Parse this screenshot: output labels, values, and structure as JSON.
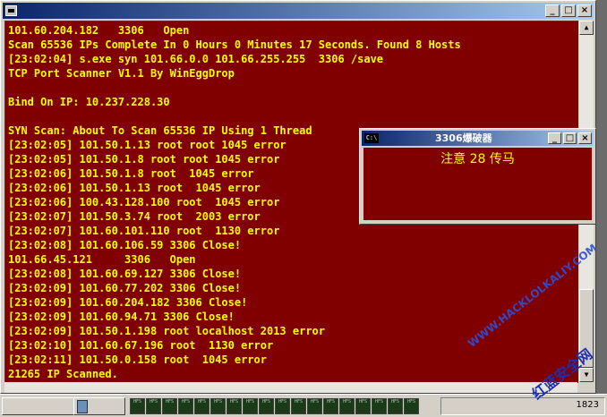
{
  "main_window": {
    "title": "",
    "console_lines": [
      "101.60.204.182   3306   Open",
      "Scan 65536 IPs Complete In 0 Hours 0 Minutes 17 Seconds. Found 8 Hosts",
      "[23:02:04] s.exe syn 101.66.0.0 101.66.255.255  3306 /save",
      "TCP Port Scanner V1.1 By WinEggDrop",
      "",
      "Bind On IP: 10.237.228.30",
      "",
      "SYN Scan: About To Scan 65536 IP Using 1 Thread",
      "[23:02:05] 101.50.1.13 root root 1045 error",
      "[23:02:05] 101.50.1.8 root root 1045 error",
      "[23:02:06] 101.50.1.8 root  1045 error",
      "[23:02:06] 101.50.1.13 root  1045 error",
      "[23:02:06] 100.43.128.100 root  1045 error",
      "[23:02:07] 101.50.3.74 root  2003 error",
      "[23:02:07] 101.60.101.110 root  1130 error",
      "[23:02:08] 101.60.106.59 3306 Close!",
      "101.66.45.121     3306   Open",
      "[23:02:08] 101.60.69.127 3306 Close!",
      "[23:02:09] 101.60.77.202 3306 Close!",
      "[23:02:09] 101.60.204.182 3306 Close!",
      "[23:02:09] 101.60.94.71 3306 Close!",
      "[23:02:09] 101.50.1.198 root localhost 2013 error",
      "[23:02:10] 101.60.67.196 root  1130 error",
      "[23:02:11] 101.50.0.158 root  1045 error",
      "21265 IP Scanned."
    ]
  },
  "popup_window": {
    "title": "3306爆破器",
    "icon_text": "C:\\",
    "message": "注意 28 传马"
  },
  "buttons": {
    "minimize": "_",
    "maximize": "□",
    "close": "×"
  },
  "taskbar": {
    "tray_label": "HFS",
    "tray_count": 18,
    "clock": "1823"
  },
  "watermark": {
    "url": "WWW.HACKLOLKALIY.COM",
    "site": "红蓝安全网"
  },
  "colors": {
    "console_bg": "#800000",
    "console_text": "#ffff00",
    "titlebar_active": "#0a246a"
  }
}
